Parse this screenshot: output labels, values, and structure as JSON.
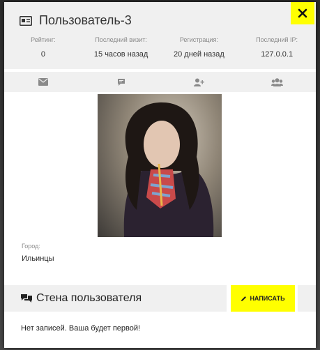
{
  "profile": {
    "title": "Пользователь-3",
    "stats": [
      {
        "label": "Рейтинг:",
        "value": "0"
      },
      {
        "label": "Последний визит:",
        "value": "15 часов назад"
      },
      {
        "label": "Регистрация:",
        "value": "20 дней назад"
      },
      {
        "label": "Последний IP:",
        "value": "127.0.0.1"
      }
    ],
    "city_label": "Город:",
    "city_value": "Ильинцы"
  },
  "actions": [
    "mail-icon",
    "comment-icon",
    "add-friend-icon",
    "group-icon"
  ],
  "wall": {
    "title": "Стена пользователя",
    "write_label": "НАПИСАТЬ",
    "empty_text": "Нет записей. Ваша будет первой!"
  },
  "colors": {
    "accent": "#ffff00",
    "panel": "#f0f0f0",
    "icon": "#8a8a8a"
  }
}
